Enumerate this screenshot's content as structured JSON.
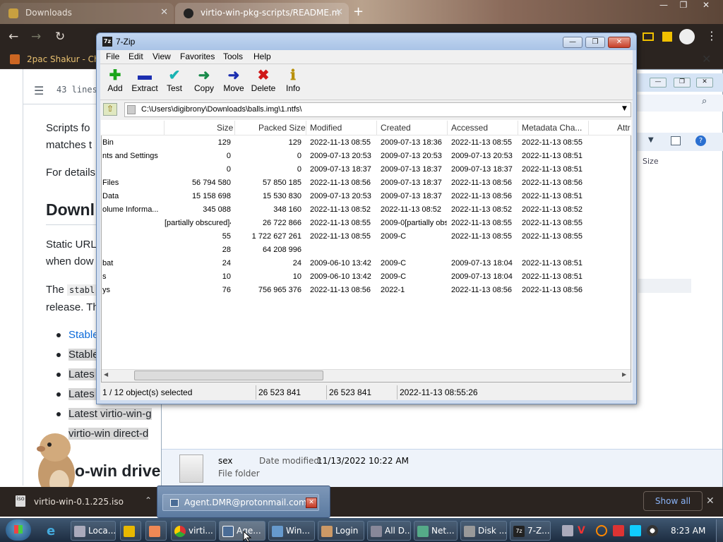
{
  "browser": {
    "tabs": [
      {
        "label": "Downloads",
        "active": false
      },
      {
        "label": "virtio-win-pkg-scripts/README.m",
        "active": true
      }
    ],
    "new_tab": "+",
    "window_controls": {
      "minimize": "—",
      "restore": "❐",
      "close": "✕"
    },
    "bookmark": "2pac Shakur - Chro",
    "download_bar": {
      "file": "virtio-win-0.1.225.iso",
      "show_all": "Show all",
      "close": "✕"
    }
  },
  "github": {
    "lines": "43 lines",
    "para1a": "Scripts fo",
    "para1b": "matches t",
    "para2": "For details",
    "heading1": "Downl",
    "para3a": "Static URL",
    "para3b": "when dow",
    "para4a": "The",
    "para4code": "stabl",
    "para4b": "release. Th",
    "bullets": [
      "Stable",
      "Stable",
      "Lates",
      "Lates",
      "Latest virtio-win-g"
    ],
    "direct": "virtio-win direct-d",
    "heading2": "o-win drive"
  },
  "explorer": {
    "size_col": "Size",
    "folder_name": "sex",
    "date_label": "Date modified:",
    "date_value": "11/13/2022 10:22 AM",
    "type": "File folder"
  },
  "zip": {
    "title": "7-Zip",
    "menu": [
      "File",
      "Edit",
      "View",
      "Favorites",
      "Tools",
      "Help"
    ],
    "tools": [
      {
        "label": "Add",
        "icon": "add-icon",
        "glyph": "✚",
        "color": "#1aa51a"
      },
      {
        "label": "Extract",
        "icon": "extract-icon",
        "glyph": "▬",
        "color": "#1c2fb0"
      },
      {
        "label": "Test",
        "icon": "test-icon",
        "glyph": "✔",
        "color": "#18b3b3"
      },
      {
        "label": "Copy",
        "icon": "copy-icon",
        "glyph": "➜",
        "color": "#188a4a"
      },
      {
        "label": "Move",
        "icon": "move-icon",
        "glyph": "➜",
        "color": "#1c2fb0"
      },
      {
        "label": "Delete",
        "icon": "delete-icon",
        "glyph": "✖",
        "color": "#d01818"
      },
      {
        "label": "Info",
        "icon": "info-icon",
        "glyph": "ℹ",
        "color": "#b8900a"
      }
    ],
    "path": "C:\\Users\\digibrony\\Downloads\\balls.img\\1.ntfs\\",
    "columns": [
      "Size",
      "Packed Size",
      "Modified",
      "Created",
      "Accessed",
      "Metadata Cha...",
      "Attr"
    ],
    "rows": [
      {
        "name": "Bin",
        "size": "129",
        "packed": "129",
        "modified": "2022-11-13 08:55",
        "created": "2009-07-13 18:36",
        "accessed": "2022-11-13 08:55",
        "meta": "2022-11-13 08:55"
      },
      {
        "name": "nts and Settings",
        "size": "0",
        "packed": "0",
        "modified": "2009-07-13 20:53",
        "created": "2009-07-13 20:53",
        "accessed": "2009-07-13 20:53",
        "meta": "2022-11-13 08:51"
      },
      {
        "name": "",
        "size": "0",
        "packed": "0",
        "modified": "2009-07-13 18:37",
        "created": "2009-07-13 18:37",
        "accessed": "2009-07-13 18:37",
        "meta": "2022-11-13 08:51"
      },
      {
        "name": "Files",
        "size": "56 794 580",
        "packed": "57 850 185",
        "modified": "2022-11-13 08:56",
        "created": "2009-07-13 18:37",
        "accessed": "2022-11-13 08:56",
        "meta": "2022-11-13 08:56"
      },
      {
        "name": "Data",
        "size": "15 158 698",
        "packed": "15 530 830",
        "modified": "2009-07-13 20:53",
        "created": "2009-07-13 18:37",
        "accessed": "2022-11-13 08:56",
        "meta": "2022-11-13 08:51"
      },
      {
        "name": "olume Informa...",
        "size": "345 088",
        "packed": "348 160",
        "modified": "2022-11-13 08:52",
        "created": "2022-11-13 08:52",
        "accessed": "2022-11-13 08:52",
        "meta": "2022-11-13 08:52"
      },
      {
        "name": "",
        "size": "[partially obscured]41",
        "packed": "26 722 866",
        "modified": "2022-11-13 08:55",
        "created": "2009-0[partially obscured]",
        "accessed": "2022-11-13 08:55",
        "meta": "2022-11-13 08:55"
      },
      {
        "name": "",
        "size": "55",
        "packed": "1 722 627 261",
        "modified": "2022-11-13 08:55",
        "created": "2009-C",
        "accessed": "2022-11-13 08:55",
        "meta": "2022-11-13 08:55"
      },
      {
        "name": "",
        "size": "28",
        "packed": "64 208 996",
        "modified": "",
        "created": "",
        "accessed": "",
        "meta": ""
      },
      {
        "name": "bat",
        "size": "24",
        "packed": "24",
        "modified": "2009-06-10 13:42",
        "created": "2009-C",
        "accessed": "2009-07-13 18:04",
        "meta": "2022-11-13 08:51"
      },
      {
        "name": "s",
        "size": "10",
        "packed": "10",
        "modified": "2009-06-10 13:42",
        "created": "2009-C",
        "accessed": "2009-07-13 18:04",
        "meta": "2022-11-13 08:51"
      },
      {
        "name": "ys",
        "size": "76",
        "packed": "756 965 376",
        "modified": "2022-11-13 08:56",
        "created": "2022-1",
        "accessed": "2022-11-13 08:56",
        "meta": "2022-11-13 08:56"
      }
    ],
    "status": {
      "selected": "1 / 12 object(s) selected",
      "size": "26 523 841",
      "packed": "26 523 841",
      "date": "2022-11-13 08:55:26"
    }
  },
  "popup": {
    "email": "Agent.DMR@protonmail.com"
  },
  "taskbar": {
    "items": [
      "Loca...",
      "",
      "",
      "virti...",
      "Age...",
      "Win...",
      "Login",
      "All D...",
      "Net...",
      "Disk ...",
      "7-Z..."
    ],
    "clock": "8:23 AM"
  }
}
